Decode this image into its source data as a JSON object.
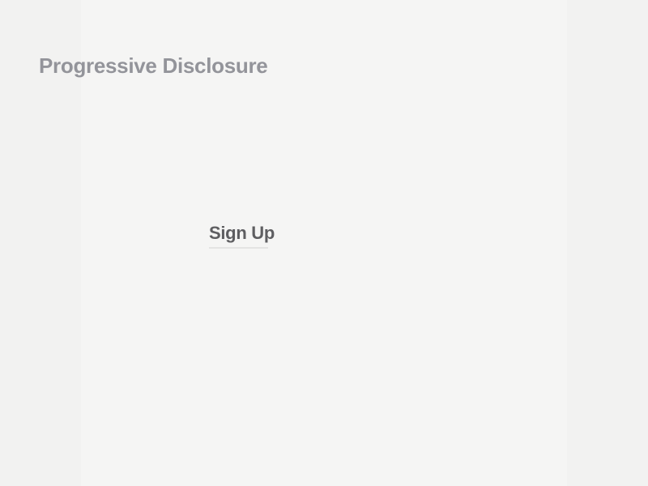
{
  "page": {
    "title": "Progressive Disclosure"
  },
  "form": {
    "heading": "Sign Up"
  }
}
